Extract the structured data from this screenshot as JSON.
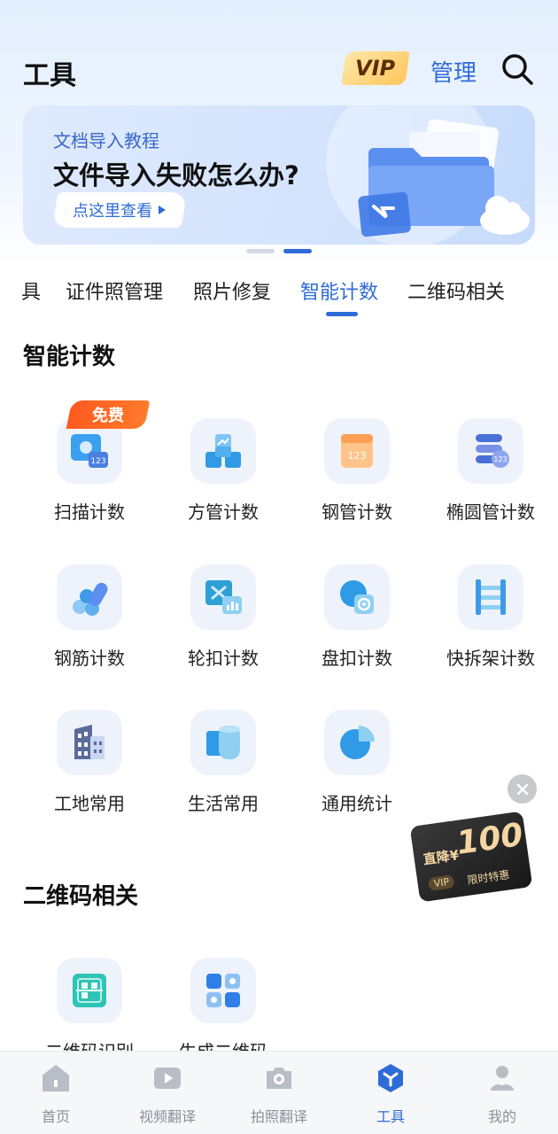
{
  "header": {
    "title": "工具",
    "vip_label": "VIP",
    "manage_label": "管理"
  },
  "banner": {
    "subtitle": "文档导入教程",
    "title": "文件导入失败怎么办?",
    "button_label": "点这里查看"
  },
  "tabs": [
    {
      "label": "具"
    },
    {
      "label": "证件照管理"
    },
    {
      "label": "照片修复"
    },
    {
      "label": "智能计数",
      "active": true
    },
    {
      "label": "二维码相关"
    }
  ],
  "sections": [
    {
      "title": "智能计数",
      "tools": [
        {
          "label": "扫描计数",
          "icon": "scan-count-icon",
          "tag": "免费"
        },
        {
          "label": "方管计数",
          "icon": "square-tube-icon"
        },
        {
          "label": "钢管计数",
          "icon": "steel-pipe-icon"
        },
        {
          "label": "椭圆管计数",
          "icon": "oval-tube-icon"
        },
        {
          "label": "钢筋计数",
          "icon": "rebar-icon"
        },
        {
          "label": "轮扣计数",
          "icon": "wheel-buckle-icon"
        },
        {
          "label": "盘扣计数",
          "icon": "disc-buckle-icon"
        },
        {
          "label": "快拆架计数",
          "icon": "scaffold-icon"
        },
        {
          "label": "工地常用",
          "icon": "building-icon"
        },
        {
          "label": "生活常用",
          "icon": "roll-icon"
        },
        {
          "label": "通用统计",
          "icon": "pie-chart-icon"
        }
      ]
    },
    {
      "title": "二维码相关",
      "tools": [
        {
          "label": "二维码识别",
          "icon": "qr-scan-icon"
        },
        {
          "label": "生成二维码",
          "icon": "qr-generate-icon"
        }
      ]
    }
  ],
  "promo": {
    "prefix": "直降¥",
    "amount": "100",
    "vip_tag": "VIP",
    "note": "限时特惠"
  },
  "bottom_nav": [
    {
      "label": "首页",
      "icon": "home-icon"
    },
    {
      "label": "视频翻译",
      "icon": "video-icon"
    },
    {
      "label": "拍照翻译",
      "icon": "camera-icon"
    },
    {
      "label": "工具",
      "icon": "tools-icon",
      "active": true
    },
    {
      "label": "我的",
      "icon": "profile-icon"
    }
  ],
  "colors": {
    "accent": "#2f6bd8",
    "free_tag": "#ff5a1f",
    "icon_bg": "#eef3fb"
  }
}
